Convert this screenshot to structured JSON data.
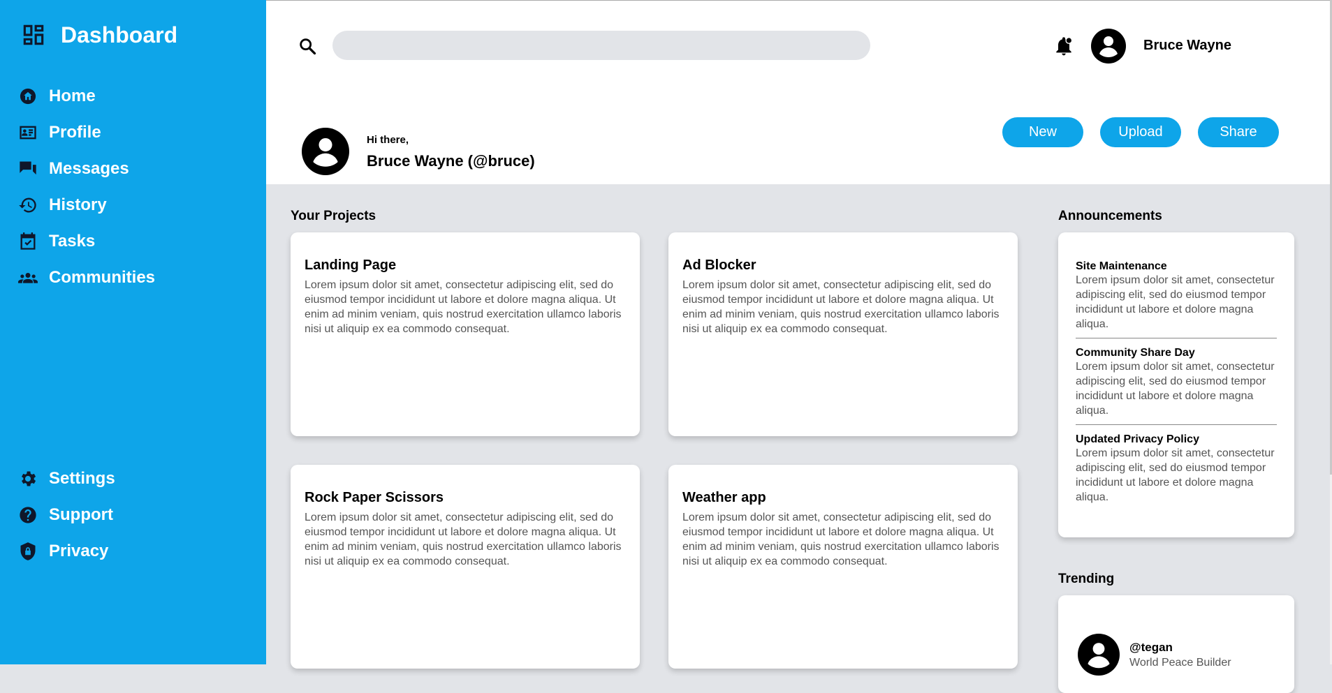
{
  "sidebar": {
    "title": "Dashboard",
    "nav": [
      {
        "label": "Home",
        "icon": "home-icon"
      },
      {
        "label": "Profile",
        "icon": "id-card-icon"
      },
      {
        "label": "Messages",
        "icon": "chat-icon"
      },
      {
        "label": "History",
        "icon": "history-icon"
      },
      {
        "label": "Tasks",
        "icon": "calendar-check-icon"
      },
      {
        "label": "Communities",
        "icon": "people-icon"
      }
    ],
    "bottom_nav": [
      {
        "label": "Settings",
        "icon": "gear-icon"
      },
      {
        "label": "Support",
        "icon": "help-icon"
      },
      {
        "label": "Privacy",
        "icon": "shield-lock-icon"
      }
    ]
  },
  "header": {
    "search_placeholder": "",
    "user_name": "Bruce Wayne",
    "greeting": "Hi there,",
    "display_name": "Bruce Wayne (@bruce)",
    "buttons": {
      "new": "New",
      "upload": "Upload",
      "share": "Share"
    }
  },
  "projects": {
    "title": "Your Projects",
    "items": [
      {
        "name": "Landing Page",
        "desc": "Lorem ipsum dolor sit amet, consectetur adipiscing elit, sed do eiusmod tempor incididunt ut labore et dolore magna aliqua. Ut enim ad minim veniam, quis nostrud exercitation ullamco laboris nisi ut aliquip ex ea commodo consequat."
      },
      {
        "name": "Ad Blocker",
        "desc": "Lorem ipsum dolor sit amet, consectetur adipiscing elit, sed do eiusmod tempor incididunt ut labore et dolore magna aliqua. Ut enim ad minim veniam, quis nostrud exercitation ullamco laboris nisi ut aliquip ex ea commodo consequat."
      },
      {
        "name": "Rock Paper Scissors",
        "desc": "Lorem ipsum dolor sit amet, consectetur adipiscing elit, sed do eiusmod tempor incididunt ut labore et dolore magna aliqua. Ut enim ad minim veniam, quis nostrud exercitation ullamco laboris nisi ut aliquip ex ea commodo consequat."
      },
      {
        "name": "Weather app",
        "desc": "Lorem ipsum dolor sit amet, consectetur adipiscing elit, sed do eiusmod tempor incididunt ut labore et dolore magna aliqua. Ut enim ad minim veniam, quis nostrud exercitation ullamco laboris nisi ut aliquip ex ea commodo consequat."
      }
    ]
  },
  "announcements": {
    "title": "Announcements",
    "items": [
      {
        "title": "Site Maintenance",
        "body": "Lorem ipsum dolor sit amet, consectetur adipiscing elit, sed do eiusmod tempor incididunt ut labore et dolore magna aliqua."
      },
      {
        "title": "Community Share Day",
        "body": "Lorem ipsum dolor sit amet, consectetur adipiscing elit, sed do eiusmod tempor incididunt ut labore et dolore magna aliqua."
      },
      {
        "title": "Updated Privacy Policy",
        "body": "Lorem ipsum dolor sit amet, consectetur adipiscing elit, sed do eiusmod tempor incididunt ut labore et dolore magna aliqua."
      }
    ]
  },
  "trending": {
    "title": "Trending",
    "items": [
      {
        "handle": "@tegan",
        "subtitle": "World Peace Builder"
      }
    ]
  },
  "colors": {
    "accent": "#0ea5e9",
    "background": "#e2e4e8",
    "card": "#ffffff"
  }
}
